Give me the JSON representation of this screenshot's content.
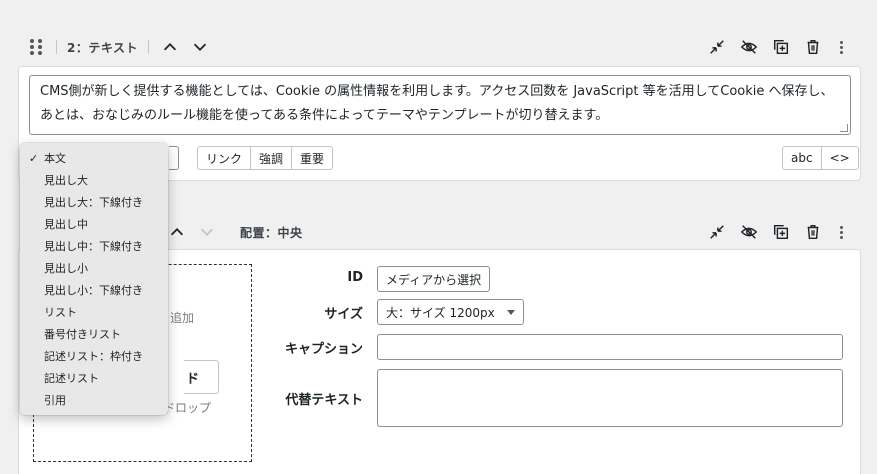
{
  "unit1": {
    "title": "2：テキスト",
    "text": "CMS側が新しく提供する機能としては、Cookie の属性情報を利用します。アクセス回数を JavaScript 等を活用してCookie へ保存し、あとは、おなじみのルール機能を使ってある条件によってテーマやテンプレートが切り替えます。",
    "inline_buttons": [
      "リンク",
      "強調",
      "重要"
    ],
    "mode_buttons": [
      "abc",
      "<>"
    ]
  },
  "unit2": {
    "placement": "配置：中央",
    "hint_add": "追加",
    "upload_label": "ド",
    "hint_drop": "ドロップ",
    "fields": {
      "id_label": "ID",
      "id_button": "メディアから選択",
      "size_label": "サイズ",
      "size_value": "大：サイズ 1200px",
      "caption_label": "キャプション",
      "alt_label": "代替テキスト"
    }
  },
  "dropdown": {
    "selected": "本文",
    "items": [
      "本文",
      "見出し大",
      "見出し大：下線付き",
      "見出し中",
      "見出し中：下線付き",
      "見出し小",
      "見出し小：下線付き",
      "リスト",
      "番号付きリスト",
      "記述リスト：枠付き",
      "記述リスト",
      "引用"
    ]
  },
  "icons": {
    "drag": "drag-handle-icon",
    "up": "chevron-up-icon",
    "down": "chevron-down-icon",
    "collapse": "collapse-icon",
    "hide": "eye-slash-icon",
    "duplicate": "duplicate-icon",
    "delete": "trash-icon",
    "menu": "kebab-menu-icon"
  },
  "colors": {
    "border": "#dcdcde",
    "text": "#1d2327",
    "muted": "#787c82"
  }
}
